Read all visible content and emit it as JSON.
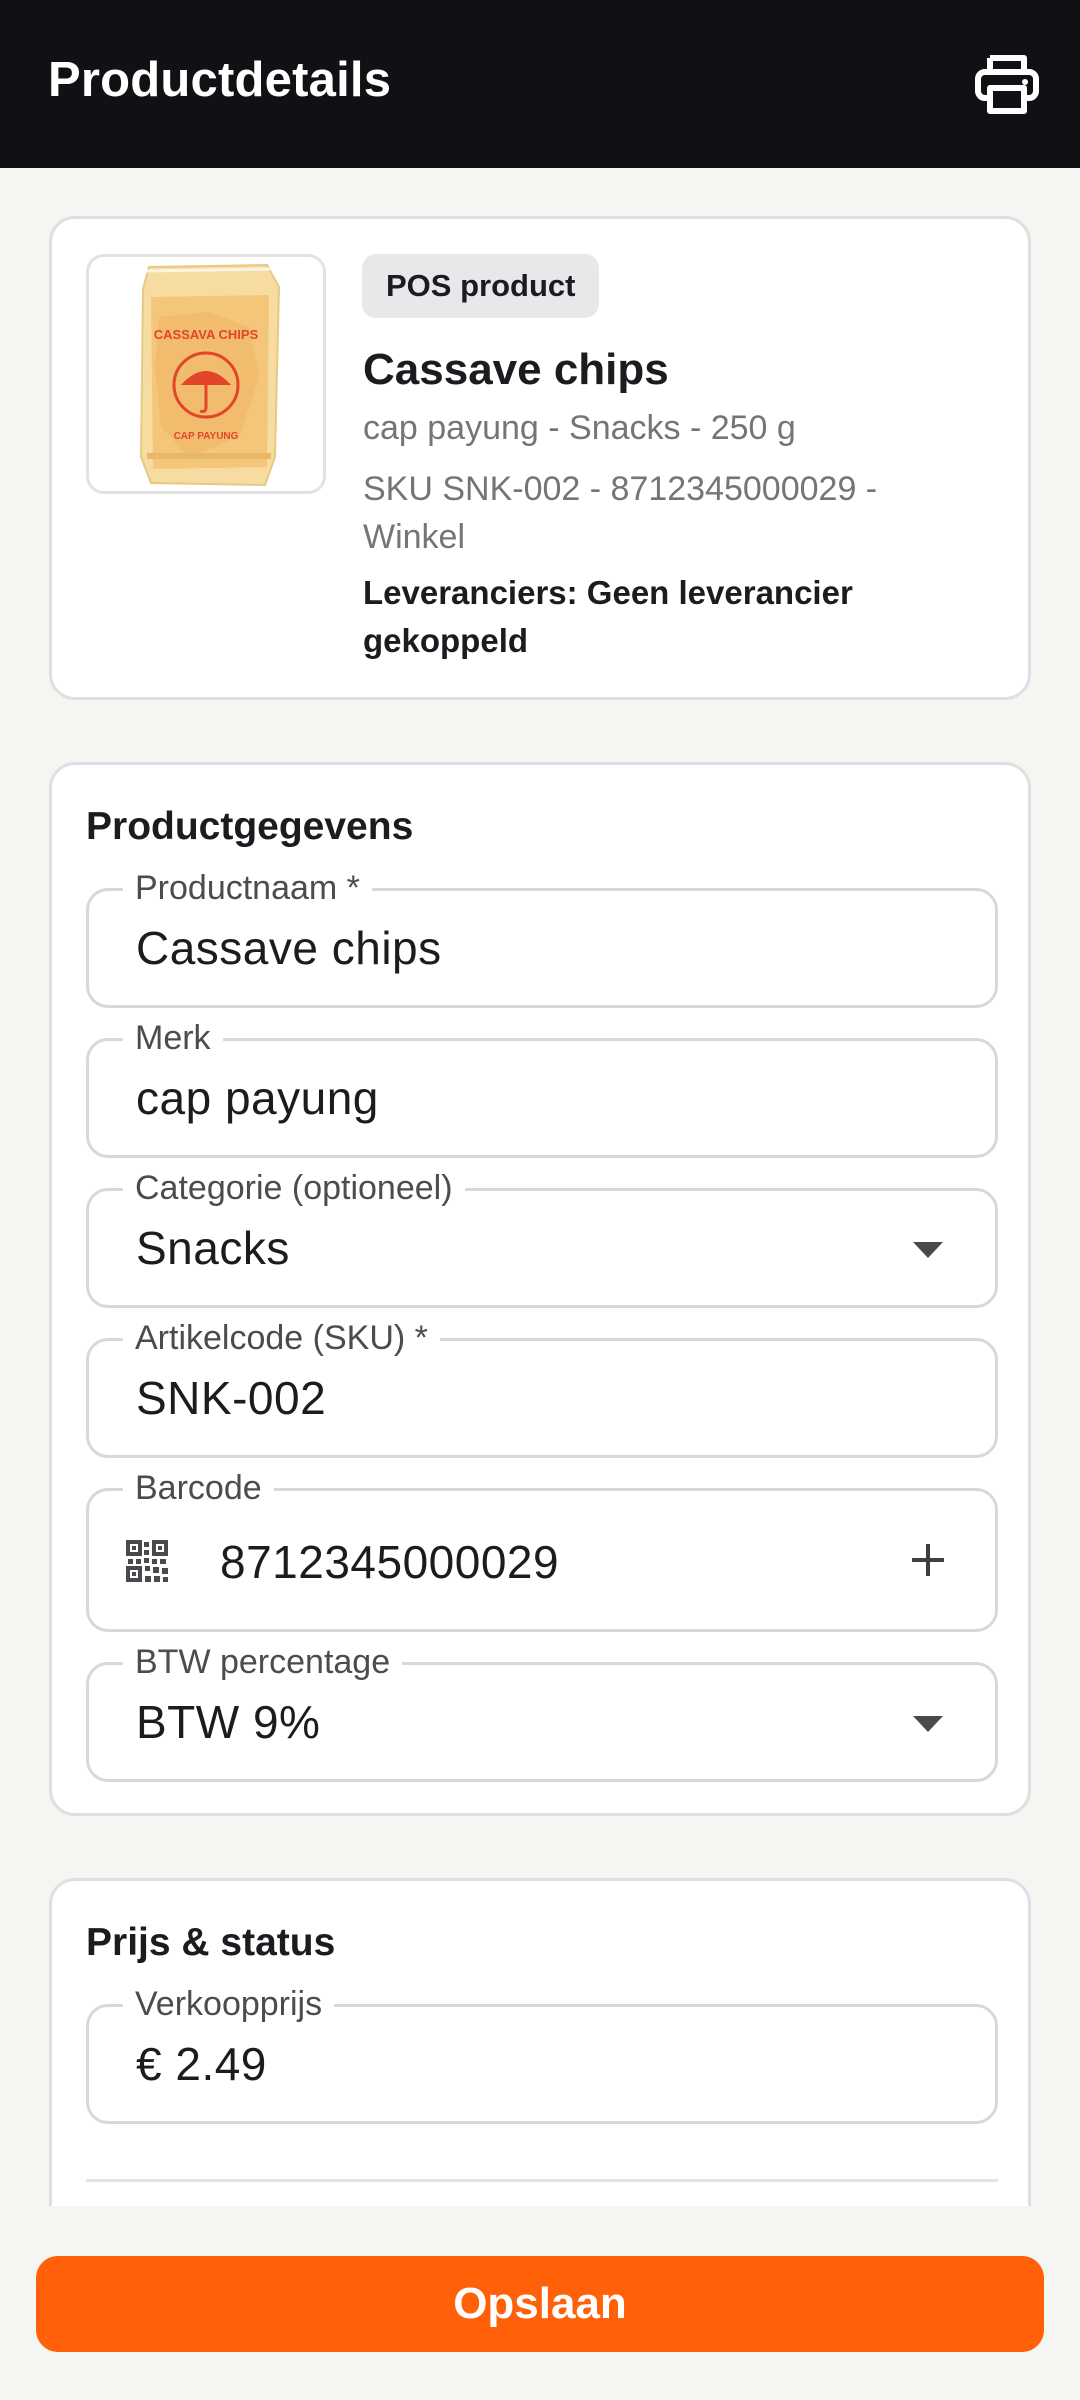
{
  "header": {
    "title": "Productdetails",
    "print_icon": "printer-icon"
  },
  "product_card": {
    "image_alt": "Cassave chips package photo",
    "badge": "POS product",
    "name": "Cassave chips",
    "subtitle": "cap payung - Snacks - 250 g",
    "sku_line": "SKU SNK-002 - 8712345000029 - Winkel",
    "suppliers": "Leveranciers: Geen leverancier gekoppeld"
  },
  "product_info": {
    "title": "Productgegevens",
    "fields": {
      "name": {
        "label": "Productnaam *",
        "value": "Cassave chips"
      },
      "brand": {
        "label": "Merk",
        "value": "cap payung"
      },
      "category": {
        "label": "Categorie (optioneel)",
        "value": "Snacks"
      },
      "sku": {
        "label": "Artikelcode (SKU) *",
        "value": "SNK-002"
      },
      "barcode": {
        "label": "Barcode",
        "value": "8712345000029"
      },
      "vat": {
        "label": "BTW percentage",
        "value": "BTW 9%"
      }
    }
  },
  "price_status": {
    "title": "Prijs & status",
    "fields": {
      "price": {
        "label": "Verkoopprijs",
        "value": "€ 2.49"
      }
    }
  },
  "footer": {
    "save_label": "Opslaan"
  },
  "colors": {
    "topbar": "#101114",
    "accent": "#ff6008",
    "background": "#f5f5f2"
  }
}
